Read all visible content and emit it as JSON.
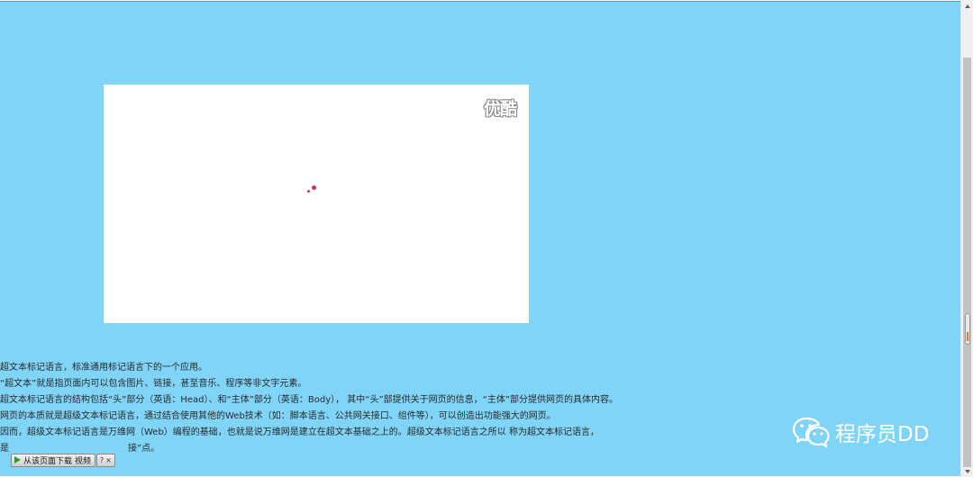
{
  "video": {
    "logo_text": "优酷"
  },
  "article": {
    "lines": [
      "超文本标记语言，标准通用标记语言下的一个应用。",
      "“超文本”就是指页面内可以包含图片、链接，甚至音乐、程序等非文字元素。",
      "超文本标记语言的结构包括“头”部分（英语：Head）、和“主体”部分（英语：Body）， 其中“头”部提供关于网页的信息，“主体”部分提供网页的具体内容。",
      "网页的本质就是超级文本标记语言，通过结合使用其他的Web技术（如：脚本语言、公共网关接口、组件等），可以创造出功能强大的网页。",
      "因而，超级文本标记语言是万维网（Web）编程的基础，也就是说万维网是建立在超文本基础之上的。超级文本标记语言之所以 称为超文本标记语言，",
      "是",
      "接”点。"
    ]
  },
  "download_toolbar": {
    "label": "从该页面下载 视频",
    "help_glyph": "?",
    "close_glyph": "×",
    "play_icon": "play-icon"
  },
  "watermark": {
    "icon": "wechat-icon",
    "text": "程序员DD"
  },
  "colors": {
    "page_background": "#7fd4f8",
    "video_background": "#ffffff",
    "loader_dot": "#c8325a",
    "text": "#2a2a2a",
    "watermark": "#ffffff"
  }
}
